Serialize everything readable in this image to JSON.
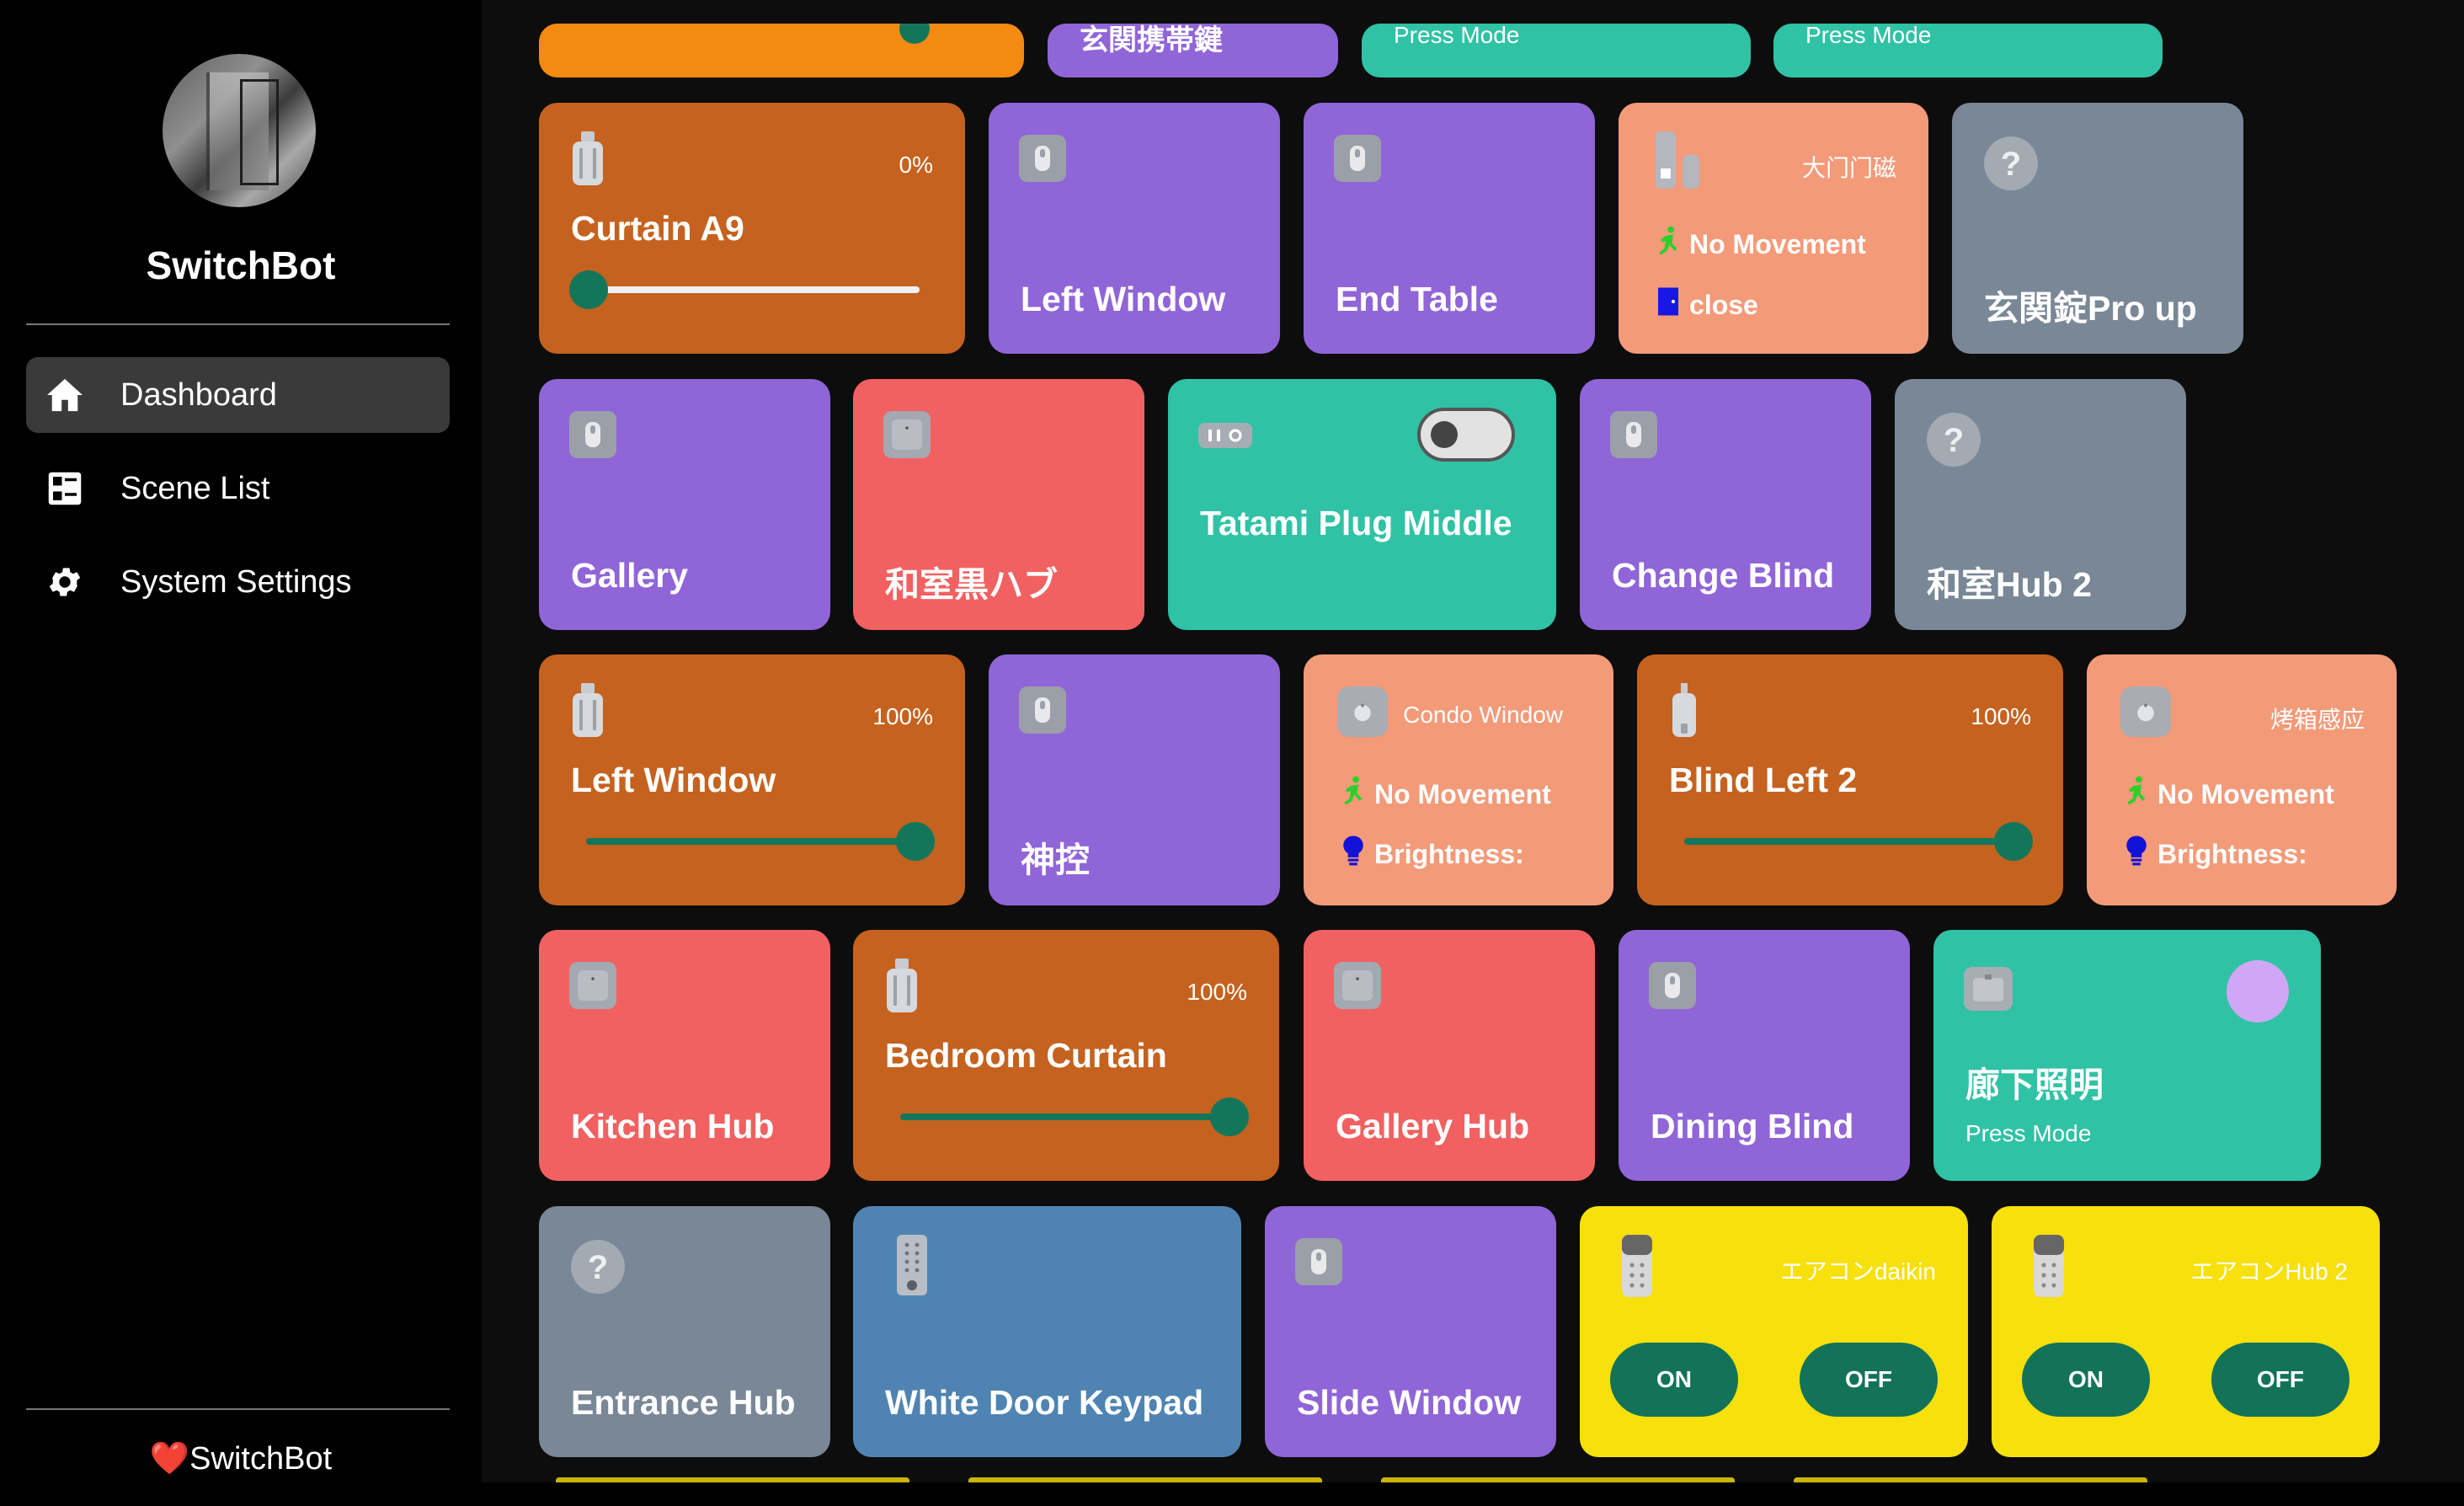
{
  "sidebar": {
    "brand": "SwitchBot",
    "nav": [
      {
        "label": "Dashboard",
        "icon": "home-icon",
        "active": true
      },
      {
        "label": "Scene List",
        "icon": "list-icon",
        "active": false
      },
      {
        "label": "System Settings",
        "icon": "gear-icon",
        "active": false
      }
    ],
    "footer": "SwitchBot"
  },
  "top_row": [
    {
      "name": "玄関携帯鍵",
      "color": "#9065d8"
    },
    {
      "sub": "Press Mode",
      "color": "#30c2a5"
    },
    {
      "sub": "Press Mode",
      "color": "#30c2a5"
    }
  ],
  "tiles": {
    "curtain_a9": {
      "name": "Curtain A9",
      "percent": "0%",
      "level": 0
    },
    "left_window_1": {
      "name": "Left Window"
    },
    "end_table": {
      "name": "End Table"
    },
    "main_door": {
      "label": "大门门磁",
      "movement": "No Movement",
      "door": "close"
    },
    "genkan_pro": {
      "name": "玄関錠Pro up"
    },
    "gallery": {
      "name": "Gallery"
    },
    "washitsu_hub": {
      "name": "和室黒ハブ"
    },
    "tatami_plug": {
      "name": "Tatami Plug Middle",
      "on": false
    },
    "change_blind": {
      "name": "Change Blind"
    },
    "washitsu_hub2": {
      "name": "和室Hub 2"
    },
    "left_window_2": {
      "name": "Left Window",
      "percent": "100%",
      "level": 100
    },
    "kamidana": {
      "name": "神控"
    },
    "condo_window": {
      "label": "Condo Window",
      "movement": "No Movement",
      "brightness": "Brightness:"
    },
    "blind_left_2": {
      "name": "Blind Left 2",
      "percent": "100%",
      "level": 100
    },
    "oven_sensor": {
      "label": "烤箱感应",
      "movement": "No Movement",
      "brightness": "Brightness:"
    },
    "kitchen_hub": {
      "name": "Kitchen Hub"
    },
    "bedroom_curtain": {
      "name": "Bedroom Curtain",
      "percent": "100%",
      "level": 100
    },
    "gallery_hub": {
      "name": "Gallery Hub"
    },
    "dining_blind": {
      "name": "Dining Blind"
    },
    "hallway_light": {
      "name": "廊下照明",
      "sub": "Press Mode"
    },
    "entrance_hub": {
      "name": "Entrance Hub"
    },
    "white_keypad": {
      "name": "White Door Keypad"
    },
    "slide_window": {
      "name": "Slide Window"
    },
    "ac_daikin": {
      "label": "エアコンdaikin",
      "on": "ON",
      "off": "OFF"
    },
    "ac_hub2": {
      "label": "エアコンHub 2",
      "on": "ON",
      "off": "OFF"
    }
  },
  "colors": {
    "orange": "#c5621f",
    "purple": "#9065d8",
    "salmon": "#f39a79",
    "gray": "#798796",
    "red": "#f16161",
    "teal": "#30c2a5",
    "blue": "#4f84b2",
    "yellow": "#f7e00b",
    "accent_green": "#127359"
  }
}
